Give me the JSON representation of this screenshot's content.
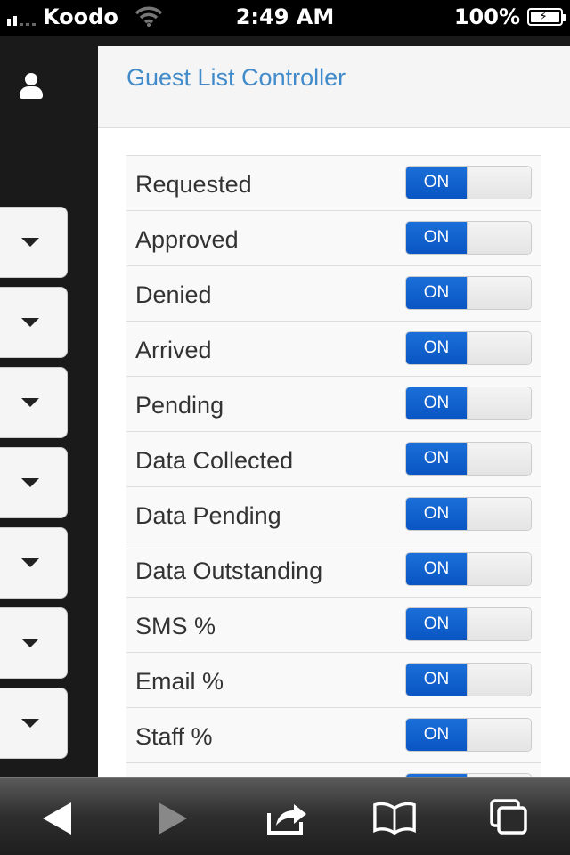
{
  "status_bar": {
    "carrier": "Koodo",
    "time": "2:49 AM",
    "battery": "100%",
    "battery_level": 1.0
  },
  "header": {
    "title": "Guest List Controller"
  },
  "sidebar": {
    "icon": "user-icon",
    "dropdown_count": 7
  },
  "toggles": [
    {
      "label": "Requested",
      "state": "ON"
    },
    {
      "label": "Approved",
      "state": "ON"
    },
    {
      "label": "Denied",
      "state": "ON"
    },
    {
      "label": "Arrived",
      "state": "ON"
    },
    {
      "label": "Pending",
      "state": "ON"
    },
    {
      "label": "Data Collected",
      "state": "ON"
    },
    {
      "label": "Data Pending",
      "state": "ON"
    },
    {
      "label": "Data Outstanding",
      "state": "ON"
    },
    {
      "label": "SMS %",
      "state": "ON"
    },
    {
      "label": "Email %",
      "state": "ON"
    },
    {
      "label": "Staff %",
      "state": "ON"
    },
    {
      "label": "",
      "state": ""
    }
  ],
  "toolbar": {
    "icons": [
      "back-icon",
      "forward-icon",
      "share-icon",
      "bookmarks-icon",
      "tabs-icon"
    ]
  },
  "colors": {
    "accent": "#428bca",
    "toggle_on": "#0b5ed0",
    "sidebar_bg": "#1a1a1a"
  }
}
